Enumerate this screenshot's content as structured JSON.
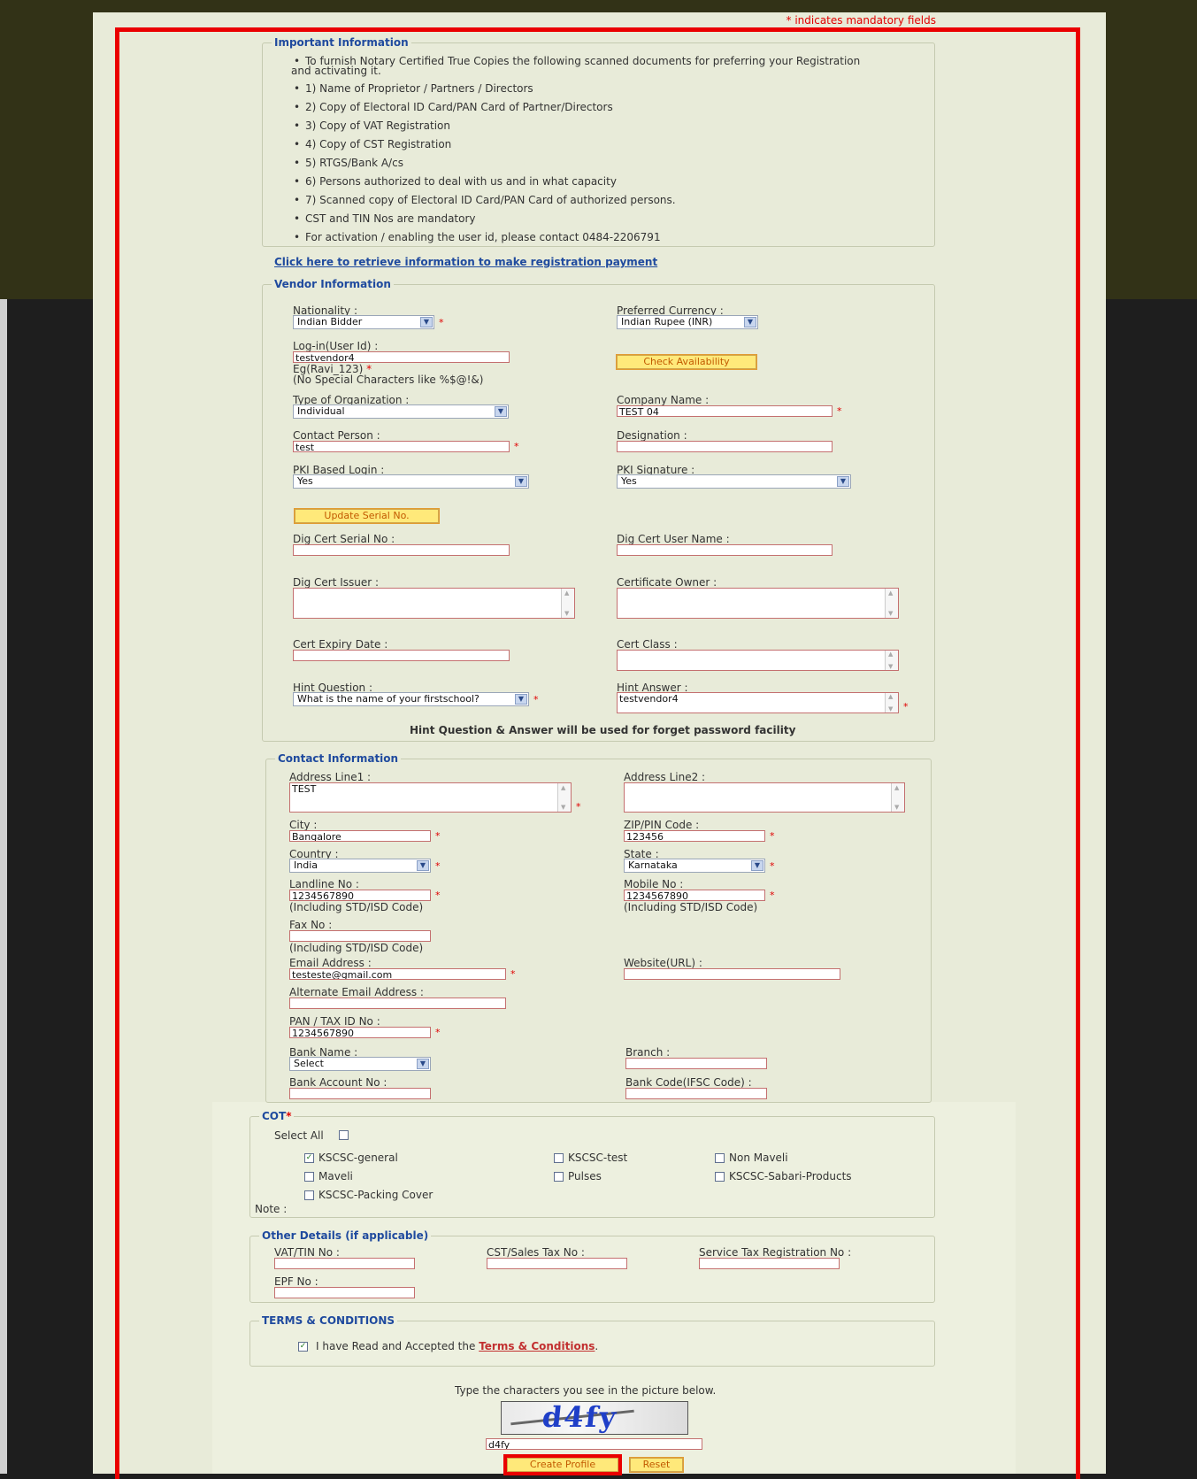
{
  "mandatory_note": "* indicates mandatory fields",
  "important": {
    "legend": "Important Information",
    "items": [
      "To furnish Notary Certified True Copies the following scanned documents for preferring your Registration",
      "1) Name of Proprietor / Partners / Directors",
      "2) Copy of Electoral ID Card/PAN Card of Partner/Directors",
      "3) Copy of VAT Registration",
      "4) Copy of CST Registration",
      "5) RTGS/Bank A/cs",
      "6) Persons authorized to deal with us and in what capacity",
      "7) Scanned copy of Electoral ID Card/PAN Card of authorized persons.",
      "CST and TIN Nos are mandatory",
      "For activation / enabling the user id, please contact 0484-2206791"
    ],
    "item0_cont": "and activating it."
  },
  "payment_link": "Click here to retrieve information to make registration payment",
  "vendor": {
    "legend": "Vendor Information",
    "nationality_label": "Nationality :",
    "nationality_value": "Indian Bidder",
    "currency_label": "Preferred Currency :",
    "currency_value": "Indian Rupee (INR)",
    "login_label": "Log-in(User Id) :",
    "login_value": "testvendor4",
    "login_hint1": "Eg(Ravi_123)",
    "login_hint2": "(No Special Characters like %$@!&)",
    "check_btn": "Check Availability",
    "org_label": "Type of Organization :",
    "org_value": "Individual",
    "company_label": "Company Name :",
    "company_value": "TEST 04",
    "contact_label": "Contact Person :",
    "contact_value": "test",
    "designation_label": "Designation :",
    "pki_login_label": "PKI Based Login :",
    "pki_login_value": "Yes",
    "pki_sig_label": "PKI Signature :",
    "pki_sig_value": "Yes",
    "update_btn": "Update Serial No.",
    "serial_label": "Dig Cert Serial No :",
    "cert_user_label": "Dig Cert User Name :",
    "issuer_label": "Dig Cert Issuer :",
    "owner_label": "Certificate Owner :",
    "expiry_label": "Cert Expiry Date :",
    "class_label": "Cert Class :",
    "hint_q_label": "Hint Question :",
    "hint_q_value": "What is the name of your firstschool?",
    "hint_a_label": "Hint Answer :",
    "hint_a_value": "testvendor4",
    "hint_note": "Hint Question & Answer will be used for forget password facility"
  },
  "contact": {
    "legend": "Contact Information",
    "addr1_label": "Address Line1 :",
    "addr1_value": "TEST",
    "addr2_label": "Address Line2 :",
    "city_label": "City :",
    "city_value": "Bangalore",
    "zip_label": "ZIP/PIN Code :",
    "zip_value": "123456",
    "country_label": "Country :",
    "country_value": "India",
    "state_label": "State :",
    "state_value": "Karnataka",
    "landline_label": "Landline No :",
    "landline_value": "1234567890",
    "mobile_label": "Mobile No :",
    "mobile_value": "1234567890",
    "std_note": "(Including STD/ISD Code)",
    "fax_label": "Fax No :",
    "email_label": "Email Address :",
    "email_value": "testeste@gmail.com",
    "website_label": "Website(URL) :",
    "alt_email_label": "Alternate Email Address :",
    "pan_label": "PAN / TAX ID No :",
    "pan_value": "1234567890",
    "bank_label": "Bank Name :",
    "bank_value": "Select",
    "branch_label": "Branch :",
    "account_label": "Bank Account No :",
    "ifsc_label": "Bank Code(IFSC Code) :"
  },
  "cot": {
    "legend": "COT",
    "select_all": "Select All",
    "options": [
      "KSCSC-general",
      "KSCSC-test",
      "Non Maveli",
      "Maveli",
      "Pulses",
      "KSCSC-Sabari-Products",
      "KSCSC-Packing Cover"
    ],
    "checked": [
      true,
      false,
      false,
      false,
      false,
      false,
      false
    ],
    "note": "Note :"
  },
  "other": {
    "legend": "Other Details (if applicable)",
    "vat_label": "VAT/TIN No :",
    "cst_label": "CST/Sales Tax No :",
    "service_label": "Service Tax Registration No :",
    "epf_label": "EPF No :"
  },
  "terms": {
    "legend": "TERMS & CONDITIONS",
    "text": "I have Read and Accepted the",
    "link": "Terms & Conditions",
    "period": ".",
    "checked": true
  },
  "captcha": {
    "prompt": "Type the characters you see in the picture below.",
    "image_text": "d4fy",
    "input_value": "d4fy"
  },
  "buttons": {
    "create": "Create Profile",
    "reset": "Reset"
  },
  "colors": {
    "mandatory_red": "#e00000",
    "legend_blue": "#1f4a9e",
    "frame_red": "#ea0000",
    "button_yellow": "#ffe97a"
  }
}
